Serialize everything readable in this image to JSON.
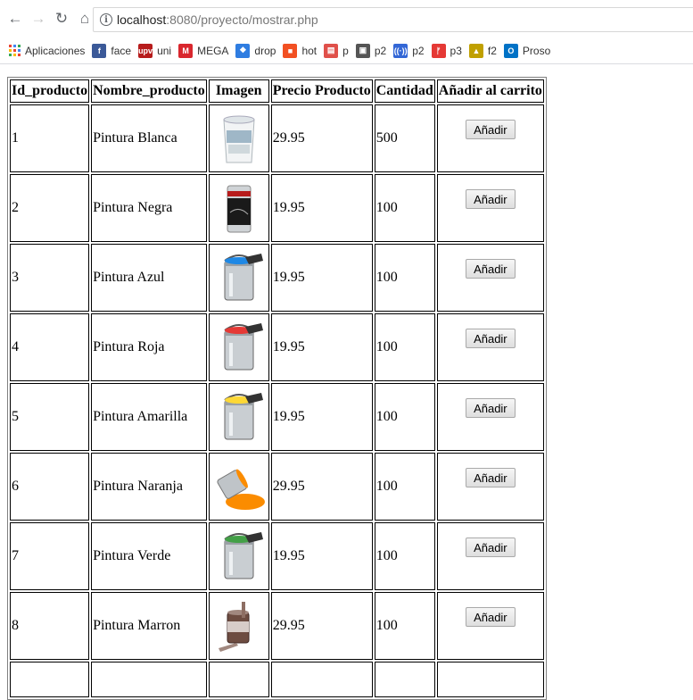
{
  "browser": {
    "url_host": "localhost",
    "url_path": ":8080/proyecto/mostrar.php",
    "bookmarks": [
      {
        "label": "Aplicaciones",
        "icon": "apps-grid-icon"
      },
      {
        "label": "face",
        "icon": "facebook-icon",
        "color": "#3b5998",
        "glyph": "f"
      },
      {
        "label": "uni",
        "icon": "upv-icon",
        "color": "#b71c1c",
        "glyph": "upv"
      },
      {
        "label": "MEGA",
        "icon": "mega-icon",
        "color": "#d9272e",
        "glyph": "M"
      },
      {
        "label": "drop",
        "icon": "dropbox-icon",
        "color": "#2f7de1",
        "glyph": "❖"
      },
      {
        "label": "hot",
        "icon": "hotmail-icon",
        "color": "#f25022",
        "glyph": "■"
      },
      {
        "label": "p",
        "icon": "pdf-icon",
        "color": "#e0504a",
        "glyph": "▤"
      },
      {
        "label": "p2",
        "icon": "image-icon",
        "color": "#555555",
        "glyph": "▣"
      },
      {
        "label": "p2",
        "icon": "radio-icon",
        "color": "#3367d6",
        "glyph": "((·))"
      },
      {
        "label": "p3",
        "icon": "flame-icon",
        "color": "#e53935",
        "glyph": "ᚠ"
      },
      {
        "label": "f2",
        "icon": "people-icon",
        "color": "#c0a000",
        "glyph": "▲"
      },
      {
        "label": "Proso",
        "icon": "outlook-icon",
        "color": "#0072c6",
        "glyph": "O"
      }
    ]
  },
  "table": {
    "headers": [
      "Id_producto",
      "Nombre_producto",
      "Imagen",
      "Precio Producto",
      "Cantidad",
      "Añadir al carrito"
    ],
    "button_label": "Añadir",
    "rows": [
      {
        "id": "1",
        "name": "Pintura Blanca",
        "image": "white-paint-bucket",
        "price": "29.95",
        "qty": "500",
        "color": "#e8ecef"
      },
      {
        "id": "2",
        "name": "Pintura Negra",
        "image": "black-paint-can",
        "price": "19.95",
        "qty": "100",
        "color": "#222222"
      },
      {
        "id": "3",
        "name": "Pintura Azul",
        "image": "blue-paint-can",
        "price": "19.95",
        "qty": "100",
        "color": "#1e88e5"
      },
      {
        "id": "4",
        "name": "Pintura Roja",
        "image": "red-paint-can",
        "price": "19.95",
        "qty": "100",
        "color": "#e53935"
      },
      {
        "id": "5",
        "name": "Pintura Amarilla",
        "image": "yellow-paint-can",
        "price": "19.95",
        "qty": "100",
        "color": "#fdd835"
      },
      {
        "id": "6",
        "name": "Pintura Naranja",
        "image": "orange-paint-spill",
        "price": "29.95",
        "qty": "100",
        "color": "#fb8c00"
      },
      {
        "id": "7",
        "name": "Pintura Verde",
        "image": "green-paint-can",
        "price": "19.95",
        "qty": "100",
        "color": "#43a047"
      },
      {
        "id": "8",
        "name": "Pintura Marron",
        "image": "brown-paint-pot",
        "price": "29.95",
        "qty": "100",
        "color": "#8d6e63"
      }
    ]
  }
}
